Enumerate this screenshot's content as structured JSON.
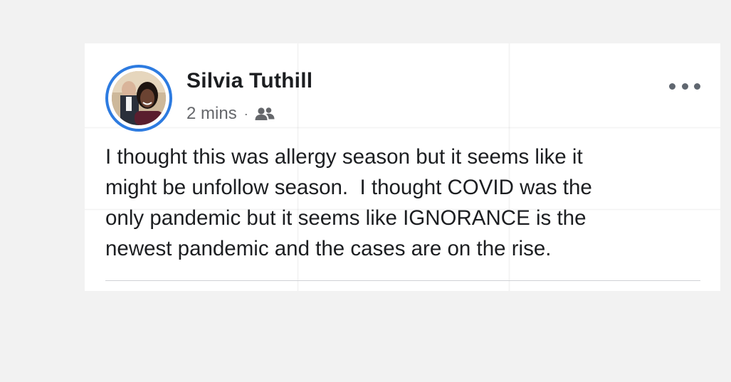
{
  "post": {
    "author_name": "Silvia Tuthill",
    "timestamp": "2 mins",
    "separator": "·",
    "audience_icon": "friends-icon",
    "more_icon": "more-options-icon",
    "body_text": "I thought this was allergy season but it seems like it\nmight be unfollow season.  I thought COVID was the\nonly pandemic but it seems like IGNORANCE is the\nnewest pandemic and the cases are on the rise.",
    "colors": {
      "avatar_ring": "#2d7be0",
      "name_text": "#1c1e21",
      "meta_text": "#65676b",
      "card_background": "#ffffff",
      "page_background": "#f2f2f2"
    }
  }
}
